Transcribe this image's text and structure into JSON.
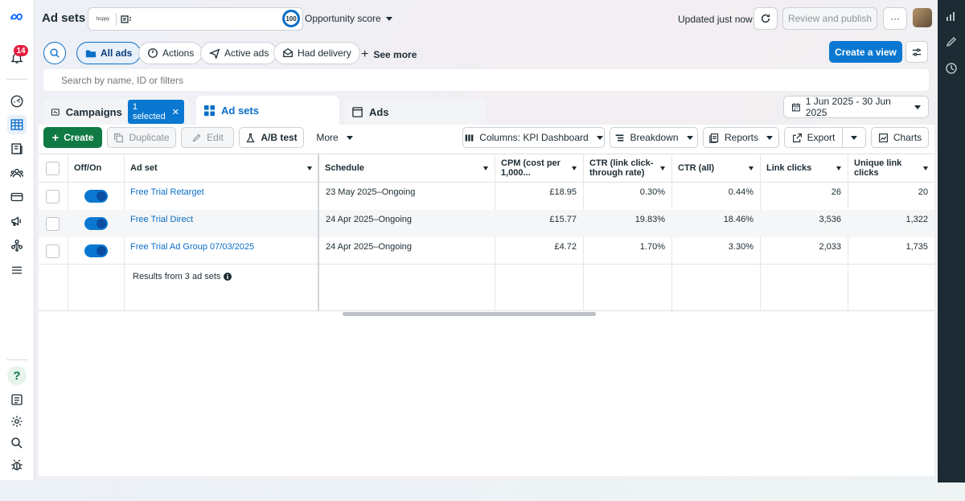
{
  "colors": {
    "accent": "#0a78d1",
    "create": "#0f7a43",
    "badge": "#e41e3f"
  },
  "rail": {
    "icons": [
      "meta-logo-icon",
      "notification-icon",
      "dashboard-icon",
      "ads-manager-icon",
      "pages-icon",
      "audience-icon",
      "billing-icon",
      "campaign-icon",
      "business-icon",
      "menu-icon",
      "help-icon",
      "reports-icon",
      "settings-icon",
      "search-icon",
      "bug-icon"
    ],
    "notification_count": "14"
  },
  "header": {
    "title": "Ad sets",
    "account_logo_text": "hoppy",
    "opportunity_score": "100",
    "opportunity_label": "Opportunity score",
    "updated": "Updated just now",
    "review_label": "Review and publish",
    "more_label": "···"
  },
  "filters": {
    "pills": [
      "All ads",
      "Actions",
      "Active ads",
      "Had delivery"
    ],
    "see_more": "See more",
    "create_view": "Create a view",
    "search_placeholder": "Search by name, ID or filters"
  },
  "tabs": {
    "campaigns": "Campaigns",
    "selected_chip": "1 selected",
    "adsets": "Ad sets",
    "ads": "Ads"
  },
  "date_range": "1 Jun 2025 - 30 Jun 2025",
  "actions": {
    "create": "Create",
    "duplicate": "Duplicate",
    "edit": "Edit",
    "ab_test": "A/B test",
    "more": "More",
    "columns": "Columns: KPI Dashboard",
    "breakdown": "Breakdown",
    "reports": "Reports",
    "export": "Export",
    "charts": "Charts"
  },
  "table": {
    "headers": {
      "off_on": "Off/On",
      "ad_set": "Ad set",
      "schedule": "Schedule",
      "cpm_1": "CPM (cost per",
      "cpm_2": "1,000...",
      "ctr_link_1": "CTR (link click-",
      "ctr_link_2": "through rate)",
      "ctr_all": "CTR (all)",
      "link_clicks": "Link clicks",
      "unique_1": "Unique link",
      "unique_2": "clicks"
    },
    "rows": [
      {
        "ad_set": "Free Trial Retarget",
        "schedule": "23 May 2025–Ongoing",
        "cpm": "£18.95",
        "ctr_link": "0.30%",
        "ctr_all": "0.44%",
        "link_clicks": "26",
        "unique_link_clicks": "20",
        "on": true
      },
      {
        "ad_set": "Free Trial Direct",
        "schedule": "24 Apr 2025–Ongoing",
        "cpm": "£15.77",
        "ctr_link": "19.83%",
        "ctr_all": "18.46%",
        "link_clicks": "3,536",
        "unique_link_clicks": "1,322",
        "on": true
      },
      {
        "ad_set": "Free Trial Ad Group 07/03/2025",
        "schedule": "24 Apr 2025–Ongoing",
        "cpm": "£4.72",
        "ctr_link": "1.70%",
        "ctr_all": "3.30%",
        "link_clicks": "2,033",
        "unique_link_clicks": "1,735",
        "on": true
      }
    ],
    "results_text": "Results from 3 ad sets"
  }
}
